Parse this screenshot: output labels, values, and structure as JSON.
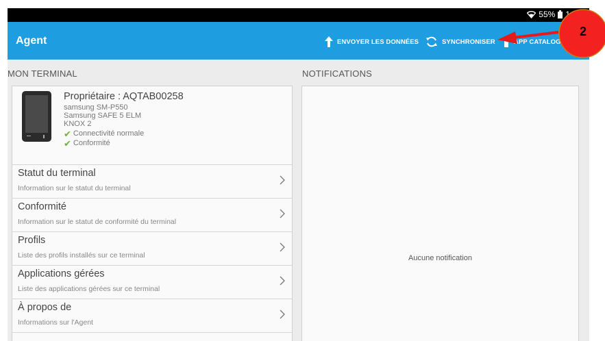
{
  "statusbar": {
    "battery": "55%",
    "time": "1"
  },
  "header": {
    "title": "Agent",
    "actions": [
      {
        "label": "ENVOYER LES DONNÉES",
        "icon": "upload-arrow-icon"
      },
      {
        "label": "SYNCHRONISER",
        "icon": "sync-icon"
      },
      {
        "label": "APP CATALOG",
        "icon": "catalog-icon"
      }
    ]
  },
  "left": {
    "section_title": "MON TERMINAL",
    "device": {
      "owner": "Propriétaire : AQTAB00258",
      "model": "samsung SM-P550",
      "safe": "Samsung SAFE 5 ELM",
      "knox": "KNOX 2",
      "status": [
        "Connectivité normale",
        "Conformité"
      ]
    },
    "items": [
      {
        "title": "Statut du terminal",
        "subtitle": "Information sur le statut du terminal"
      },
      {
        "title": "Conformité",
        "subtitle": "Information sur le statut de conformité du terminal"
      },
      {
        "title": "Profils",
        "subtitle": "Liste des profils installés sur ce terminal"
      },
      {
        "title": "Applications gérées",
        "subtitle": "Liste des applications gérées sur ce terminal"
      },
      {
        "title": "À propos de",
        "subtitle": "Informations sur l'Agent"
      }
    ]
  },
  "right": {
    "section_title": "NOTIFICATIONS",
    "empty_text": "Aucune notification"
  },
  "annotation": {
    "number": "2"
  },
  "colors": {
    "header": "#1e9de0",
    "annotation": "#e51b1b",
    "badge": "#f42121",
    "check": "#6bb23a"
  }
}
